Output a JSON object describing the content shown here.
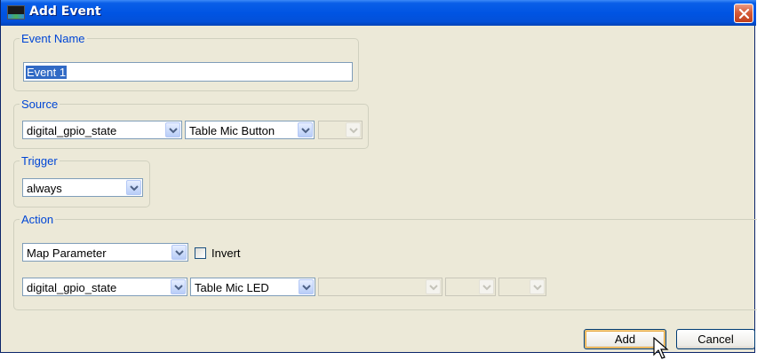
{
  "window": {
    "title": "Add Event"
  },
  "event_name": {
    "legend": "Event Name",
    "value": "Event 1"
  },
  "source": {
    "legend": "Source",
    "combo1": "digital_gpio_state",
    "combo2": "Table Mic Button",
    "combo3": ""
  },
  "trigger": {
    "legend": "Trigger",
    "combo": "always"
  },
  "action": {
    "legend": "Action",
    "mode_combo": "Map Parameter",
    "invert_label": "Invert",
    "invert_checked": false,
    "target_combo1": "digital_gpio_state",
    "target_combo2": "Table Mic LED",
    "target_combo3": "",
    "target_combo4": "",
    "target_combo5": ""
  },
  "buttons": {
    "add": "Add",
    "cancel": "Cancel"
  },
  "colors": {
    "titlebar": "#0054e3",
    "legend_text": "#0046d5",
    "dialog_bg": "#ece9d8",
    "selection": "#316ac5"
  }
}
